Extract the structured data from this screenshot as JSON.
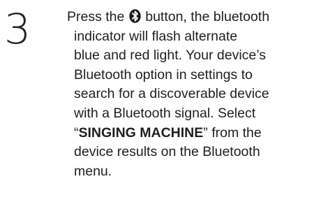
{
  "step": {
    "number": "3"
  },
  "instruction": {
    "line1_before_icon": "Press the",
    "icon": "bluetooth-icon",
    "line1_after_icon": "button, the bluetooth",
    "line2": "indicator will flash alternate",
    "line3": "blue and red light. Your device’s",
    "line4": "Bluetooth option in settings to",
    "line5": "search for a discoverable device",
    "line6": "with a Bluetooth signal.  Select",
    "line7_open_quote": "“",
    "line7_device_name": "SINGING MACHINE",
    "line7_close_quote": "”",
    "line7_rest": "from the",
    "line8": "device results on the Bluetooth",
    "line9": "menu."
  }
}
